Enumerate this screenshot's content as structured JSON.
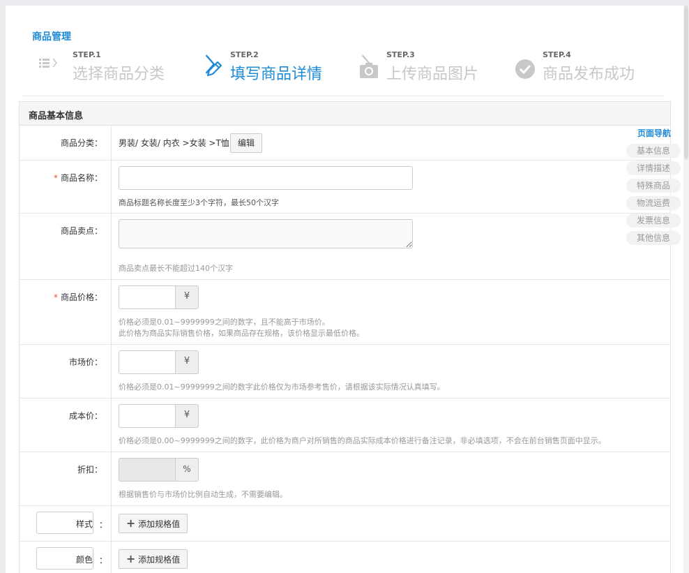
{
  "breadcrumb": "商品管理",
  "steps": [
    {
      "num": "STEP.1",
      "title": "选择商品分类",
      "icon": "list-icon"
    },
    {
      "num": "STEP.2",
      "title": "填写商品详情",
      "icon": "pencil-icon"
    },
    {
      "num": "STEP.3",
      "title": "上传商品图片",
      "icon": "camera-icon"
    },
    {
      "num": "STEP.4",
      "title": "商品发布成功",
      "icon": "check-circle-icon"
    }
  ],
  "section_title": "商品基本信息",
  "fields": {
    "category": {
      "label": "商品分类：",
      "value": "男装/ 女装/ 内衣 >女装 >T恤",
      "edit_button": "编辑"
    },
    "name": {
      "label": "商品名称：",
      "value": "",
      "hint": "商品标题名称长度至少3个字符，最长50个汉字"
    },
    "selling_point": {
      "label": "商品卖点：",
      "value": "",
      "hint": "商品卖点最长不能超过140个汉字"
    },
    "price": {
      "label": "商品价格：",
      "value": "",
      "suffix": "¥",
      "hint1": "价格必须是0.01~9999999之间的数字，且不能高于市场价。",
      "hint2": "此价格为商品实际销售价格，如果商品存在规格，该价格显示最低价格。"
    },
    "market_price": {
      "label": "市场价：",
      "value": "",
      "suffix": "¥",
      "hint": "价格必须是0.01~9999999之间的数字此价格仅为市场参考售价，请根据该实际情况认真填写。"
    },
    "cost_price": {
      "label": "成本价：",
      "value": "",
      "suffix": "¥",
      "hint": "价格必须是0.00~9999999之间的数字，此价格为商户对所销售的商品实际成本价格进行备注记录，非必填选项，不会在前台销售页面中显示。"
    },
    "discount": {
      "label": "折扣：",
      "value": "",
      "suffix": "%",
      "hint": "根据销售价与市场价比例自动生成，不需要编辑。"
    },
    "spec_style": {
      "label": "样式",
      "colon": "：",
      "add_button": "添加规格值"
    },
    "spec_color": {
      "label": "颜色",
      "colon": "：",
      "add_button": "添加规格值"
    }
  },
  "required_mark": "*",
  "page_nav": {
    "title": "页面导航",
    "items": [
      "基本信息",
      "详情描述",
      "特殊商品",
      "物流运费",
      "发票信息",
      "其他信息"
    ]
  },
  "colors": {
    "accent": "#1f8ad8",
    "required": "#e05a2b",
    "muted": "#c8c8c8"
  }
}
